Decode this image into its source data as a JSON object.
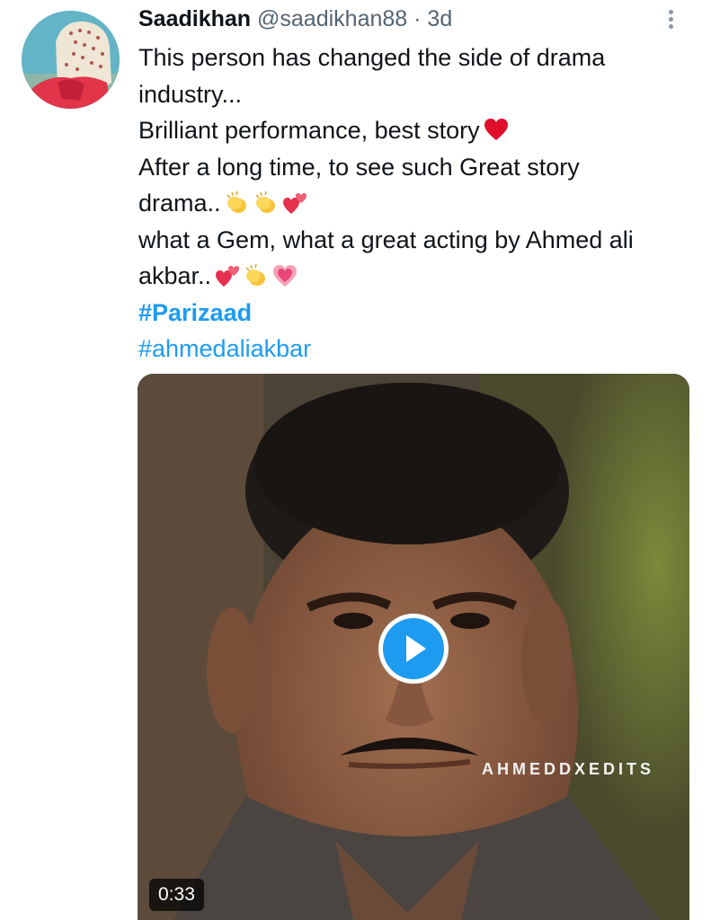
{
  "tweet": {
    "display_name": "Saadikhan",
    "handle": "@saadikhan88",
    "separator": "·",
    "time": "3d",
    "lines": [
      "This person has changed the side of drama",
      "industry...",
      "Brilliant performance, best story",
      "After a long time, to see such Great story",
      "drama..",
      "what a Gem, what a great acting by Ahmed ali",
      "akbar.."
    ],
    "hashtags": [
      "#Parizaad",
      "#ahmedaliakbar"
    ]
  },
  "media": {
    "watermark": "AHMEDDXEDITS",
    "duration": "0:33"
  },
  "icons": {
    "more": "more-vertical-icon",
    "play": "play-icon",
    "heart": "red-heart-emoji",
    "clap": "clapping-hands-emoji",
    "two_hearts": "two-hearts-emoji",
    "growing_heart": "growing-heart-emoji"
  },
  "colors": {
    "link": "#1d9bf0",
    "secondary_text": "#536471",
    "primary_text": "#0f1419"
  }
}
